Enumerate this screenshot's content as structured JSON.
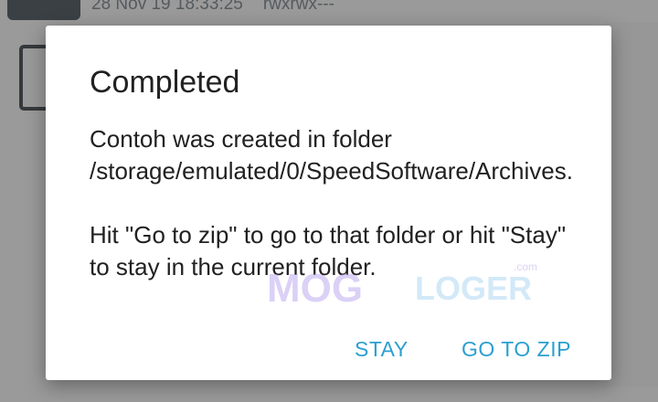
{
  "background": {
    "file_meta": {
      "date": "28 Nov 19 18:33:25",
      "permissions": "rwxrwx---"
    }
  },
  "dialog": {
    "title": "Completed",
    "message_line1": "Contoh was created in folder /storage/emulated/0/SpeedSoftware/Archives.",
    "message_line2": "Hit \"Go to zip\" to go to that folder or hit \"Stay\" to stay in the current folder.",
    "buttons": {
      "stay": "STAY",
      "go_to_zip": "GO TO ZIP"
    }
  },
  "watermark": {
    "left_text": "MOG",
    "right_text": "LOGER",
    "suffix": ".com"
  },
  "colors": {
    "accent": "#2b9fd0",
    "dialog_background": "#ffffff",
    "scrim": "#9a9a9a",
    "text_primary": "#212121"
  }
}
